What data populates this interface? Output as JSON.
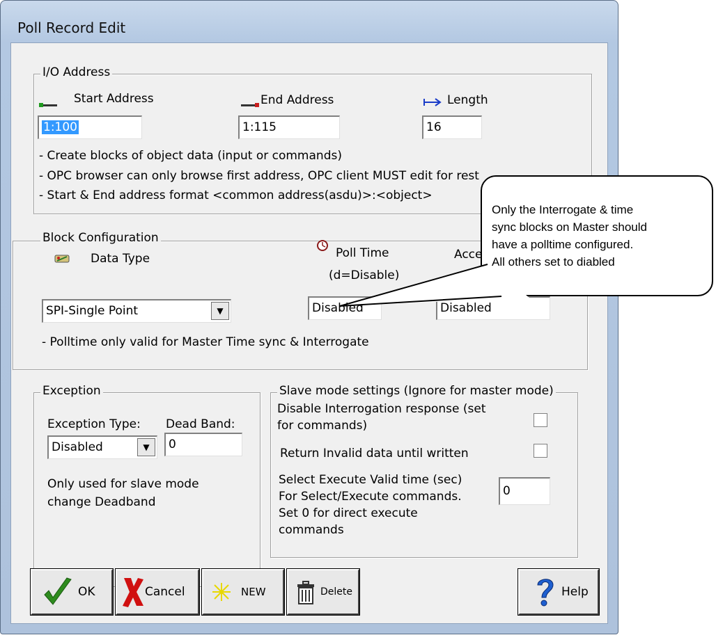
{
  "window": {
    "title": "Poll Record Edit"
  },
  "io_address": {
    "legend": "I/O Address",
    "start_label": "Start Address",
    "end_label": "End Address",
    "length_label": "Length",
    "start_value": "1:100",
    "end_value": "1:115",
    "length_value": "16",
    "notes": [
      "- Create blocks of object data (input or commands)",
      "- OPC browser can only browse first address, OPC client MUST edit for rest",
      "- Start & End address format <common address(asdu)>:<object>"
    ]
  },
  "block_config": {
    "legend": "Block Configuration",
    "data_type_label": "Data Type",
    "poll_time_label": "Poll Time",
    "poll_time_hint": "(d=Disable)",
    "access_label": "Access",
    "data_type_value": "SPI-Single Point",
    "poll_time_value": "Disabled",
    "access_value": "Disabled",
    "note": "- Polltime only valid for Master Time sync & Interrogate"
  },
  "exception": {
    "legend": "Exception",
    "type_label": "Exception Type:",
    "deadband_label": "Dead Band:",
    "type_value": "Disabled",
    "deadband_value": "0",
    "note_line1": "Only used for slave mode",
    "note_line2": "change Deadband"
  },
  "slave": {
    "legend": "Slave mode settings (Ignore for master mode)",
    "disable_interrogation_line1": "Disable Interrogation response (set",
    "disable_interrogation_line2": "for commands)",
    "return_invalid": "Return Invalid data until written",
    "select_exec_line1": "Select Execute Valid time (sec)",
    "select_exec_line2": "For Select/Execute commands.",
    "select_exec_line3": " Set 0 for direct execute",
    "select_exec_line4": "commands",
    "select_exec_value": "0"
  },
  "buttons": {
    "ok": "OK",
    "cancel": "Cancel",
    "new": "NEW",
    "delete": "Delete",
    "help": "Help"
  },
  "callout": {
    "line1": "Only the Interrogate & time",
    "line2": "sync blocks on Master should",
    "line3": "have a polltime configured.",
    "line4": "All others set to diabled"
  },
  "icons": [
    "start-address-icon",
    "end-address-icon",
    "length-arrow-icon",
    "data-type-icon",
    "clock-icon",
    "ok-check-icon",
    "cancel-x-icon",
    "new-star-icon",
    "trash-icon",
    "help-question-icon"
  ],
  "colors": {
    "selection": "#3399ff",
    "length_arrow": "#1a3cc8",
    "start_marker": "#1f9a1f",
    "end_marker": "#c81e1e",
    "ok_check": "#2e8b1e",
    "cancel_x": "#d01010",
    "help_q": "#1e5fd0"
  }
}
